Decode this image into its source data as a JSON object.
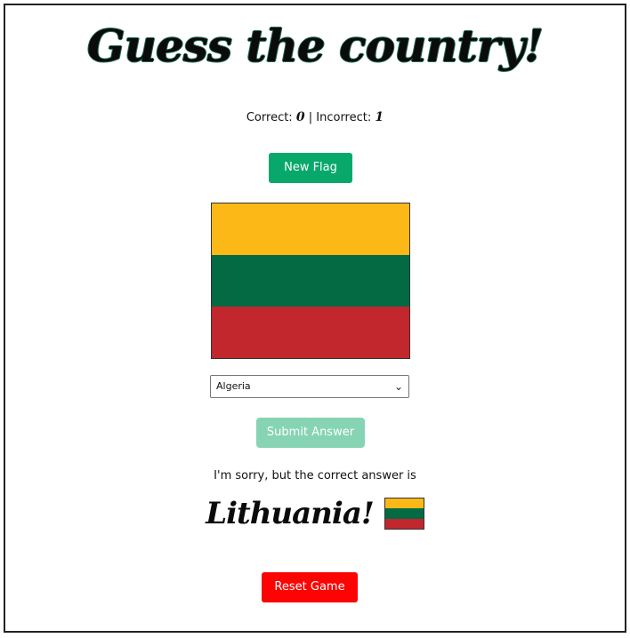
{
  "header": {
    "title": "Guess the country",
    "title_mark": "!"
  },
  "score": {
    "correct_label": "Correct:",
    "correct_value": "0",
    "separator": "|",
    "incorrect_label": "Incorrect:",
    "incorrect_value": "1"
  },
  "buttons": {
    "new_flag": "New Flag",
    "submit": "Submit Answer",
    "reset": "Reset Game"
  },
  "flag": {
    "icon": "lithuania-flag-icon",
    "stripes": [
      "#fbb817",
      "#036a44",
      "#c1272d"
    ]
  },
  "select": {
    "selected": "Algeria",
    "icon": "chevron-down-icon"
  },
  "result": {
    "message": "I'm sorry, but the correct answer is",
    "answer": "Lithuania",
    "answer_mark": "!"
  },
  "colors": {
    "new_flag_button": "#08a86b",
    "submit_button_disabled": "#86d4b4",
    "reset_button": "#fc0404"
  }
}
